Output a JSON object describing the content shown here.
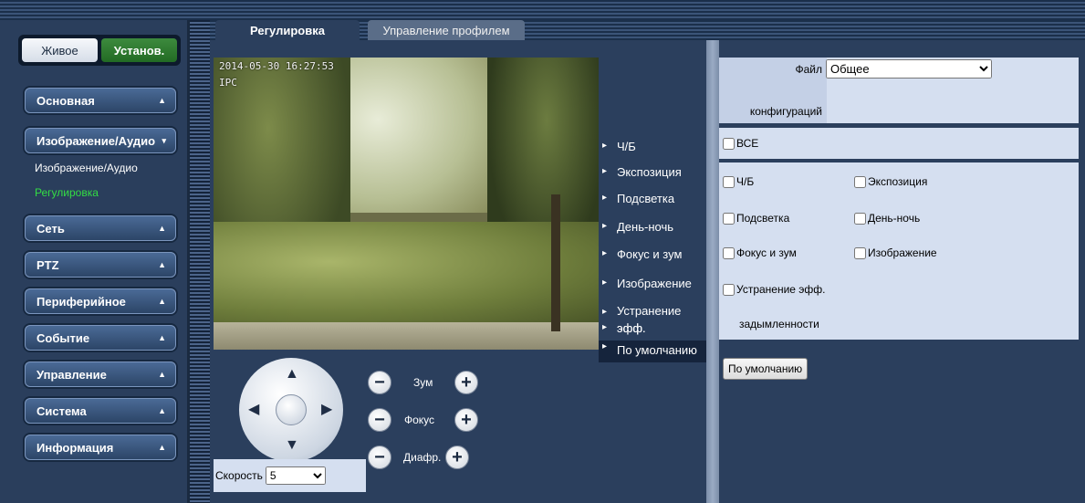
{
  "mode": {
    "live": "Живое",
    "setup": "Установ."
  },
  "sidebar": {
    "items": [
      {
        "label": "Основная",
        "arrow": "▲"
      },
      {
        "label": "Изображение/Аудио",
        "arrow": "▾"
      },
      {
        "label": "Сеть",
        "arrow": "▲"
      },
      {
        "label": "PTZ",
        "arrow": "▲"
      },
      {
        "label": "Периферийное",
        "arrow": "▲"
      },
      {
        "label": "Событие",
        "arrow": "▲"
      },
      {
        "label": "Управление",
        "arrow": "▲"
      },
      {
        "label": "Система",
        "arrow": "▲"
      },
      {
        "label": "Информация",
        "arrow": "▲"
      }
    ],
    "subitems": [
      {
        "label": "Изображение/Аудио"
      },
      {
        "label": "Регулировка",
        "active": true
      }
    ]
  },
  "tabs": [
    {
      "label": "Регулировка",
      "active": true
    },
    {
      "label": "Управление профилем",
      "active": false
    }
  ],
  "video": {
    "timestamp": "2014-05-30 16:27:53",
    "channel": "IPC"
  },
  "ptz": {
    "zoom_label": "Зум",
    "focus_label": "Фокус",
    "iris_label": "Диафр.",
    "minus": "−",
    "plus": "+",
    "speed_label": "Скорость",
    "speed_value": "5"
  },
  "settings_list": [
    {
      "label": "Ч/Б"
    },
    {
      "label": "Экспозиция"
    },
    {
      "label": "Подсветка"
    },
    {
      "label": "День-ночь"
    },
    {
      "label": "Фокус и зум"
    },
    {
      "label": "Изображение"
    },
    {
      "label": "Устранение эфф."
    },
    {
      "label": "По умолчанию",
      "selected": true
    }
  ],
  "config": {
    "file_label_line1": "Файл",
    "file_label_line2": "конфигураций",
    "file_value": "Общее",
    "all_label": "ВСЕ",
    "checkboxes": [
      {
        "label": "Ч/Б"
      },
      {
        "label": "Экспозиция"
      },
      {
        "label": "Подсветка"
      },
      {
        "label": "День-ночь"
      },
      {
        "label": "Фокус и зум"
      },
      {
        "label": "Изображение"
      },
      {
        "label": "Устранение эфф."
      }
    ],
    "defog_line2": "задымленности",
    "default_button": "По умолчанию"
  },
  "colors": {
    "panel_bg": "#2b3f5d",
    "active_green": "#33dd44",
    "form_bg": "#d5dff0"
  }
}
